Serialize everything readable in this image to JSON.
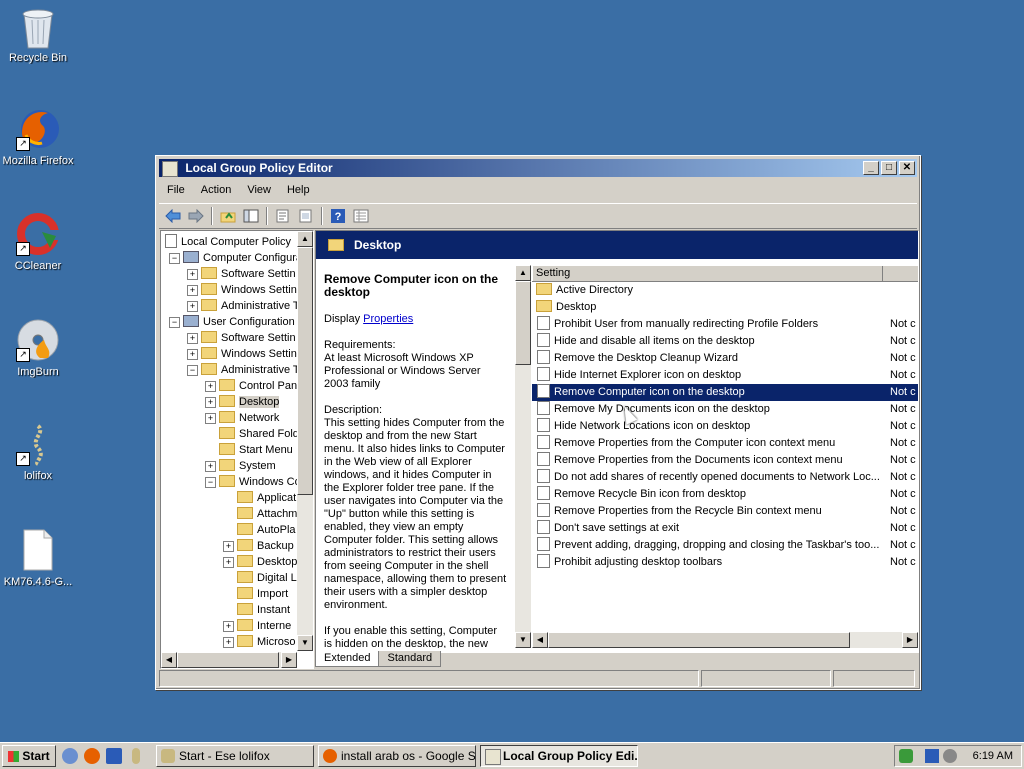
{
  "desktop": {
    "icons": [
      {
        "label": "Recycle Bin",
        "icon": "recycle-bin-icon"
      },
      {
        "label": "Mozilla Firefox",
        "icon": "firefox-icon"
      },
      {
        "label": "CCleaner",
        "icon": "ccleaner-icon"
      },
      {
        "label": "ImgBurn",
        "icon": "imgburn-icon"
      },
      {
        "label": "lolifox",
        "icon": "lolifox-icon"
      },
      {
        "label": "KM76.4.6-G...",
        "icon": "file-icon"
      }
    ],
    "background_color": "#3a6ea5"
  },
  "window": {
    "title": "Local Group Policy Editor",
    "controls": {
      "minimize": "_",
      "maximize": "□",
      "close": "✕"
    },
    "menu": [
      "File",
      "Action",
      "View",
      "Help"
    ],
    "toolbar_icons": [
      "back-arrow-icon",
      "forward-arrow-icon",
      "up-folder-icon",
      "show-hide-tree-icon",
      "properties-icon",
      "export-list-icon",
      "help-icon",
      "filter-icon"
    ]
  },
  "tree": {
    "items": [
      {
        "label": "Local Computer Policy",
        "indent": 0,
        "expander": ""
      },
      {
        "label": "Computer Configura",
        "indent": 1,
        "expander": "−"
      },
      {
        "label": "Software Settin",
        "indent": 2,
        "expander": "+"
      },
      {
        "label": "Windows Settin",
        "indent": 2,
        "expander": "+"
      },
      {
        "label": "Administrative T",
        "indent": 2,
        "expander": "+"
      },
      {
        "label": "User Configuration",
        "indent": 1,
        "expander": "−"
      },
      {
        "label": "Software Settin",
        "indent": 2,
        "expander": "+"
      },
      {
        "label": "Windows Settin",
        "indent": 2,
        "expander": "+"
      },
      {
        "label": "Administrative T",
        "indent": 2,
        "expander": "−"
      },
      {
        "label": "Control Pan",
        "indent": 3,
        "expander": "+"
      },
      {
        "label": "Desktop",
        "indent": 3,
        "expander": "+",
        "selected": true
      },
      {
        "label": "Network",
        "indent": 3,
        "expander": "+"
      },
      {
        "label": "Shared Fold",
        "indent": 3,
        "expander": ""
      },
      {
        "label": "Start Menu",
        "indent": 3,
        "expander": ""
      },
      {
        "label": "System",
        "indent": 3,
        "expander": "+"
      },
      {
        "label": "Windows Co",
        "indent": 3,
        "expander": "−"
      },
      {
        "label": "Applicat",
        "indent": 4,
        "expander": ""
      },
      {
        "label": "Attachm",
        "indent": 4,
        "expander": ""
      },
      {
        "label": "AutoPla",
        "indent": 4,
        "expander": ""
      },
      {
        "label": "Backup",
        "indent": 4,
        "expander": "+"
      },
      {
        "label": "Desktop",
        "indent": 4,
        "expander": "+"
      },
      {
        "label": "Digital L",
        "indent": 4,
        "expander": ""
      },
      {
        "label": "Import",
        "indent": 4,
        "expander": ""
      },
      {
        "label": "Instant",
        "indent": 4,
        "expander": ""
      },
      {
        "label": "Interne",
        "indent": 4,
        "expander": "+"
      },
      {
        "label": "Microso",
        "indent": 4,
        "expander": "+"
      }
    ]
  },
  "right": {
    "header": "Desktop",
    "description": {
      "title": "Remove Computer icon on the desktop",
      "display_prefix": "Display",
      "display_link": "Properties",
      "requirements_label": "Requirements:",
      "requirements": "At least Microsoft Windows XP Professional or Windows Server 2003 family",
      "description_label": "Description:",
      "description": "This setting hides Computer from the desktop and from the new Start menu. It also hides links to Computer in the Web view of all Explorer windows, and it hides Computer in the Explorer folder tree pane. If the user navigates into Computer via the \"Up\" button while this setting is enabled, they view an empty Computer folder. This setting allows administrators to restrict their users from seeing Computer in the shell namespace, allowing them to present their users with a simpler desktop environment.",
      "enable_text": "If you enable this setting, Computer is hidden on the desktop, the new Start menu, the Explorer folder tree"
    },
    "list": {
      "col_setting": "Setting",
      "rows": [
        {
          "name": "Active Directory",
          "state": "",
          "folder": true
        },
        {
          "name": "Desktop",
          "state": "",
          "folder": true
        },
        {
          "name": "Prohibit User from manually redirecting Profile Folders",
          "state": "Not c"
        },
        {
          "name": "Hide and disable all items on the desktop",
          "state": "Not c"
        },
        {
          "name": "Remove the Desktop Cleanup Wizard",
          "state": "Not c"
        },
        {
          "name": "Hide Internet Explorer icon on desktop",
          "state": "Not c"
        },
        {
          "name": "Remove Computer icon on the desktop",
          "state": "Not c",
          "selected": true
        },
        {
          "name": "Remove My Documents icon on the desktop",
          "state": "Not c"
        },
        {
          "name": "Hide Network Locations icon on desktop",
          "state": "Not c"
        },
        {
          "name": "Remove Properties from the Computer icon context menu",
          "state": "Not c"
        },
        {
          "name": "Remove Properties from the Documents icon context menu",
          "state": "Not c"
        },
        {
          "name": "Do not add shares of recently opened documents to Network Loc...",
          "state": "Not c"
        },
        {
          "name": "Remove Recycle Bin icon from desktop",
          "state": "Not c"
        },
        {
          "name": "Remove Properties from the Recycle Bin context menu",
          "state": "Not c"
        },
        {
          "name": "Don't save settings at exit",
          "state": "Not c"
        },
        {
          "name": "Prevent adding, dragging, dropping and closing the Taskbar's too...",
          "state": "Not c"
        },
        {
          "name": "Prohibit adjusting desktop toolbars",
          "state": "Not c"
        }
      ]
    },
    "tabs": [
      "Extended",
      "Standard"
    ]
  },
  "taskbar": {
    "start": "Start",
    "quick_launch": [
      "ie-icon",
      "firefox-icon",
      "show-desktop-icon",
      "lolifox-icon"
    ],
    "tasks": [
      {
        "label": "Start - Ese lolifox",
        "icon": "lolifox-icon"
      },
      {
        "label": "install arab os - Google S...",
        "icon": "firefox-icon"
      },
      {
        "label": "Local Group Policy Edi...",
        "icon": "gpedit-icon",
        "active": true
      }
    ],
    "tray_icons": [
      "security-shield-icon",
      "network-icon",
      "volume-muted-icon"
    ],
    "clock": "6:19 AM"
  }
}
